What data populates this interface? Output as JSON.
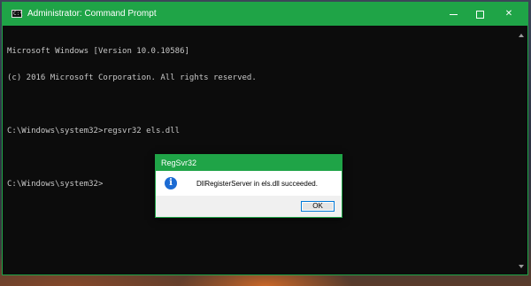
{
  "window": {
    "title": "Administrator: Command Prompt",
    "app_icon_glyph": "C:\\",
    "accent_color": "#1fa447",
    "controls": [
      "minimize-icon",
      "maximize-icon",
      "close-icon"
    ],
    "close_glyph": "✕"
  },
  "console": {
    "lines": [
      "Microsoft Windows [Version 10.0.10586]",
      "(c) 2016 Microsoft Corporation. All rights reserved.",
      "",
      "C:\\Windows\\system32>regsvr32 els.dll",
      "",
      "C:\\Windows\\system32>"
    ],
    "text_color": "#c8c8c8",
    "background_color": "#0c0c0c"
  },
  "dialog": {
    "title": "RegSvr32",
    "icon": "info-icon",
    "icon_glyph": "i",
    "message": "DllRegisterServer in els.dll succeeded.",
    "ok_label": "OK",
    "icon_color": "#1c6bd3"
  }
}
